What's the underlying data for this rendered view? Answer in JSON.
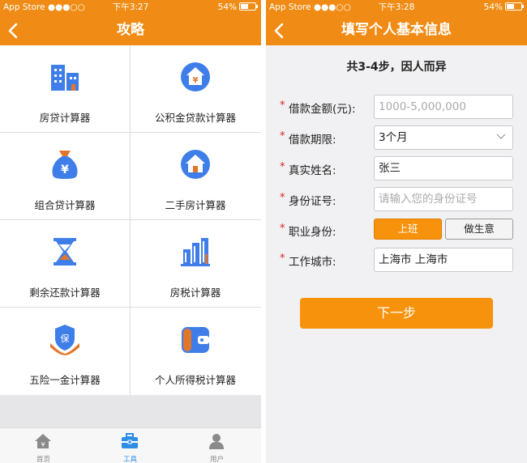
{
  "left": {
    "status": {
      "carrier": "App Store ●●●○○",
      "time": "下午3:27",
      "battery": "54%"
    },
    "title": "攻略",
    "tools": [
      {
        "label": "房贷计算器",
        "icon": "buildings-icon"
      },
      {
        "label": "公积金贷款计算器",
        "icon": "house-fund-icon"
      },
      {
        "label": "组合贷计算器",
        "icon": "money-bag-icon"
      },
      {
        "label": "二手房计算器",
        "icon": "second-hand-house-icon"
      },
      {
        "label": "剩余还款计算器",
        "icon": "hourglass-icon"
      },
      {
        "label": "房税计算器",
        "icon": "tax-building-icon"
      },
      {
        "label": "五险一金计算器",
        "icon": "insurance-shield-icon"
      },
      {
        "label": "个人所得税计算器",
        "icon": "wallet-icon"
      }
    ],
    "tabs": [
      {
        "label": "首页",
        "icon": "home-icon"
      },
      {
        "label": "工具",
        "icon": "toolbox-icon"
      },
      {
        "label": "用户",
        "icon": "user-icon"
      }
    ],
    "active_tab": "工具"
  },
  "right": {
    "status": {
      "carrier": "App Store ●●●○○",
      "time": "下午3:28",
      "battery": "54%"
    },
    "title": "填写个人基本信息",
    "subtitle": "共3-4步，因人而异",
    "fields": [
      {
        "label": "借款金额(元):",
        "placeholder": "1000-5,000,000",
        "value": ""
      },
      {
        "label": "借款期限:",
        "value": "3个月",
        "type": "select"
      },
      {
        "label": "真实姓名:",
        "value": "张三"
      },
      {
        "label": "身份证号:",
        "placeholder": "请输入您的身份证号",
        "value": ""
      },
      {
        "label": "职业身份:",
        "options": [
          "上班",
          "做生意"
        ],
        "selected": "上班"
      },
      {
        "label": "工作城市:",
        "value": "上海市 上海市"
      }
    ],
    "next_button": "下一步"
  },
  "colors": {
    "accent": "#f08c15",
    "button": "#f6920c",
    "icon_blue": "#3f7ee8",
    "required": "#e02020"
  }
}
